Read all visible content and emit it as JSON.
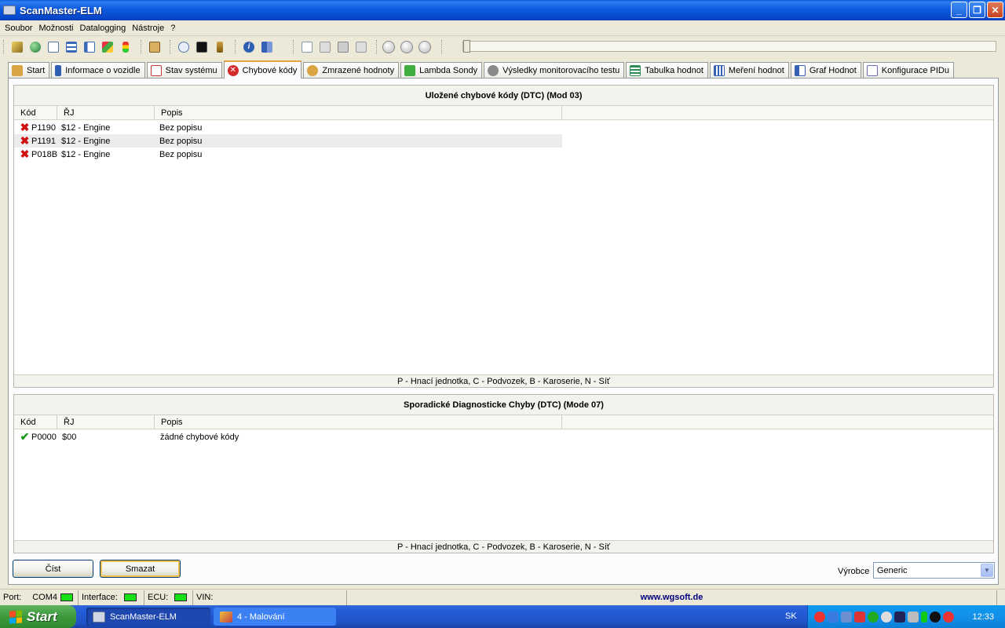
{
  "window": {
    "title": "ScanMaster-ELM"
  },
  "menu": [
    "Soubor",
    "Možnosti",
    "Datalogging",
    "Nástroje",
    "?"
  ],
  "toolbar": {
    "icons": [
      "wrench-icon",
      "globe-icon",
      "document-icon",
      "table-icon",
      "chart-icon",
      "map-icon",
      "traffic-light-icon",
      "clipboard-icon",
      "chat-icon",
      "terminal-icon",
      "battery-icon",
      "info-icon",
      "book-icon",
      "new-file-icon",
      "open-icon",
      "save-icon",
      "print-icon",
      "play-icon",
      "stop-icon",
      "record-icon"
    ]
  },
  "tabs": [
    {
      "label": "Start",
      "icon": "home-icon",
      "color": "#d9a441"
    },
    {
      "label": "Informace o vozidle",
      "icon": "info-icon",
      "color": "#2f5fb3"
    },
    {
      "label": "Stav systému",
      "icon": "checklist-icon",
      "color": "#c23a3a"
    },
    {
      "label": "Chybové kódy",
      "icon": "error-icon",
      "color": "#d32b2b",
      "active": true
    },
    {
      "label": "Zmrazené hodnoty",
      "icon": "snowflake-icon",
      "color": "#d9a441"
    },
    {
      "label": "Lambda Sondy",
      "icon": "sensor-icon",
      "color": "#3fae3f"
    },
    {
      "label": "Výsledky monitorovacího testu",
      "icon": "gear-icon",
      "color": "#7a7a7a"
    },
    {
      "label": "Tabulka hodnot",
      "icon": "list-icon",
      "color": "#2e8b57"
    },
    {
      "label": "Meření hodnot",
      "icon": "grid-icon",
      "color": "#3560b5"
    },
    {
      "label": "Graf Hodnot",
      "icon": "bar-chart-icon",
      "color": "#3560b5"
    },
    {
      "label": "Konfigurace PIDu",
      "icon": "config-icon",
      "color": "#6b6bb5"
    }
  ],
  "stored": {
    "title": "Uložené chybové kódy (DTC) (Mod 03)",
    "columns": [
      "Kód",
      "ŘJ",
      "Popis"
    ],
    "rows": [
      {
        "code": "P1190",
        "ecu": "$12 - Engine",
        "desc": "Bez popisu"
      },
      {
        "code": "P1191",
        "ecu": "$12 - Engine",
        "desc": "Bez popisu"
      },
      {
        "code": "P018B",
        "ecu": "$12 - Engine",
        "desc": "Bez popisu"
      }
    ],
    "legend": "P - Hnací jednotka, C - Podvozek, B - Karoserie, N - Síť"
  },
  "pending": {
    "title": "Sporadické Diagnosticke Chyby (DTC) (Mode 07)",
    "columns": [
      "Kód",
      "ŘJ",
      "Popis"
    ],
    "rows": [
      {
        "code": "P0000",
        "ecu": "$00",
        "desc": "žádné chybové kódy"
      }
    ],
    "legend": "P - Hnací jednotka, C - Podvozek, B - Karoserie, N - Síť"
  },
  "buttons": {
    "read": "Číst",
    "clear": "Smazat"
  },
  "manufacturer": {
    "label": "Výrobce",
    "value": "Generic"
  },
  "status": {
    "port_label": "Port:",
    "port_value": "COM4",
    "interface_label": "Interface:",
    "ecu_label": "ECU:",
    "vin_label": "VIN:",
    "site": "www.wgsoft.de",
    "led_color": "#16e016"
  },
  "taskbar": {
    "start": "Start",
    "tasks": [
      "ScanMaster-ELM",
      "4 - Malování"
    ],
    "lang": "SK",
    "clock": "12:33"
  }
}
